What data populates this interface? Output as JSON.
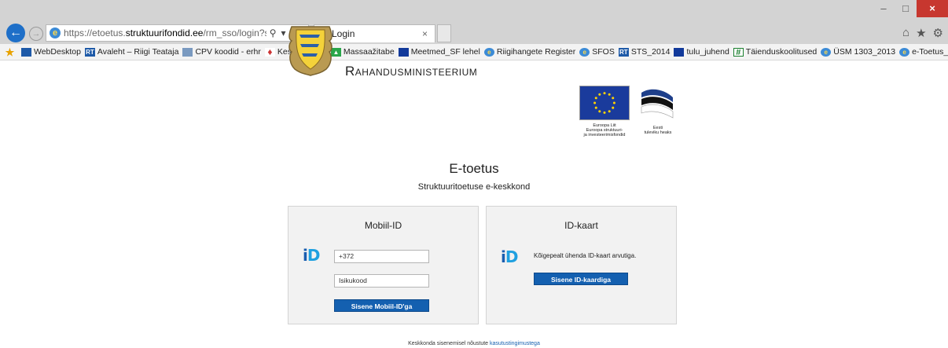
{
  "browser": {
    "url_prefix": "https://etoetus.",
    "url_domain": "struktuurifondid.ee",
    "url_path": "/rm_sso/login?service=ht",
    "tab_title": "Login",
    "window_controls": [
      "–",
      "□",
      "×"
    ],
    "icons": [
      "home-icon",
      "favorites-star-icon",
      "settings-gear-icon"
    ]
  },
  "favorites": [
    {
      "label": "WebDesktop",
      "icon": "blue",
      "glyph": ""
    },
    {
      "label": "Avaleht – Riigi Teataja",
      "icon": "blue",
      "glyph": "RT"
    },
    {
      "label": "CPV koodid - erhr",
      "icon": "gray",
      "glyph": ""
    },
    {
      "label": "Kesksüsteem",
      "icon": "red",
      "glyph": "♦"
    },
    {
      "label": "Massaažitabe",
      "icon": "green",
      "glyph": "▲"
    },
    {
      "label": "Meetmed_SF lehel",
      "icon": "navy",
      "glyph": ""
    },
    {
      "label": "Riigihangete Register",
      "icon": "ie",
      "glyph": "e"
    },
    {
      "label": "SFOS",
      "icon": "ie",
      "glyph": "e"
    },
    {
      "label": "STS_2014",
      "icon": "blue",
      "glyph": "RT"
    },
    {
      "label": "tulu_juhend",
      "icon": "navy",
      "glyph": ""
    },
    {
      "label": "Täienduskoolitused",
      "icon": "grid",
      "glyph": "#"
    },
    {
      "label": "ÜSM 1303_2013",
      "icon": "ie",
      "glyph": "e"
    },
    {
      "label": "e-Toetus_TEST",
      "icon": "ie",
      "glyph": "e"
    }
  ],
  "header": {
    "ministry": "Rahandusministeerium",
    "eu_caption": [
      "Euroopa Liit",
      "Euroopa struktuuri-",
      "ja investeerimisfondid"
    ],
    "ee_caption": [
      "Eesti",
      "tuleviku heaks"
    ]
  },
  "page": {
    "title": "E-toetus",
    "subtitle": "Struktuuritoetuse e-keskkond"
  },
  "mobile_id": {
    "heading": "Mobiil-ID",
    "phone_value": "+372",
    "personal_code_placeholder": "Isikukood",
    "submit_label": "Sisene Mobiil-ID'ga"
  },
  "id_card": {
    "heading": "ID-kaart",
    "instruction": "Kõigepealt ühenda ID-kaart arvutiga.",
    "submit_label": "Sisene ID-kaardiga"
  },
  "footer": {
    "text": "Keskkonda sisenemisel nõustute ",
    "link": "kasutustingimustega"
  },
  "colors": {
    "accent": "#1460b0",
    "close": "#c7372f",
    "panel_bg": "#f2f2f2"
  }
}
